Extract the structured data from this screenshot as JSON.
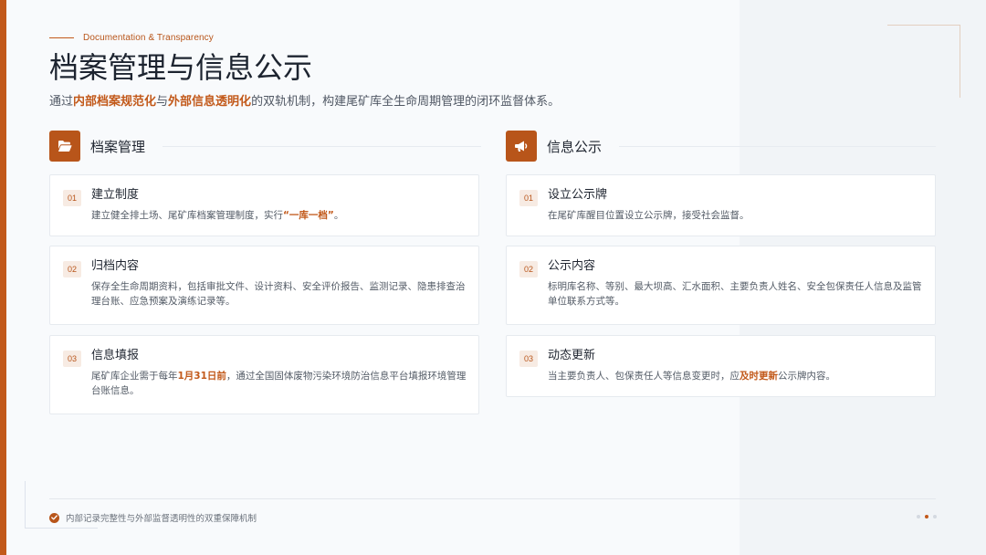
{
  "header": {
    "eyebrow": "Documentation & Transparency",
    "title": "档案管理与信息公示",
    "subtitle": {
      "p1": "通过",
      "h1": "内部档案规范化",
      "p2": "与",
      "h2": "外部信息透明化",
      "p3": "的双轨机制，构建尾矿库全生命周期管理的闭环监督体系。"
    }
  },
  "left_column": {
    "title": "档案管理",
    "icon": "folder-open-icon",
    "cards": [
      {
        "num": "01",
        "title": "建立制度",
        "d1": "建立健全排土场、尾矿库档案管理制度，实行",
        "hl": "“一库一档”",
        "d2": "。"
      },
      {
        "num": "02",
        "title": "归档内容",
        "d1": "保存全生命周期资料，包括审批文件、设计资料、安全评价报告、监测记录、隐患排查治理台账、应急预案及演练记录等。"
      },
      {
        "num": "03",
        "title": "信息填报",
        "d1": "尾矿库企业需于每年",
        "hl": "1月31日前",
        "d2": "，通过全国固体废物污染环境防治信息平台填报环境管理台账信息。"
      }
    ]
  },
  "right_column": {
    "title": "信息公示",
    "icon": "megaphone-icon",
    "cards": [
      {
        "num": "01",
        "title": "设立公示牌",
        "d1": "在尾矿库醒目位置设立公示牌，接受社会监督。"
      },
      {
        "num": "02",
        "title": "公示内容",
        "d1": "标明库名称、等别、最大坝高、汇水面积、主要负责人姓名、安全包保责任人信息及监管单位联系方式等。"
      },
      {
        "num": "03",
        "title": "动态更新",
        "d1": "当主要负责人、包保责任人等信息变更时，应",
        "hl": "及时更新",
        "d2": "公示牌内容。"
      }
    ]
  },
  "footer": {
    "text": "内部记录完整性与外部监督透明性的双重保障机制",
    "icon": "check-circle-icon",
    "page_dots": 3,
    "active_dot": 2
  },
  "colors": {
    "accent": "#c2591a",
    "title": "#1d2430",
    "body": "#535b66",
    "background": "#f8fafc"
  }
}
